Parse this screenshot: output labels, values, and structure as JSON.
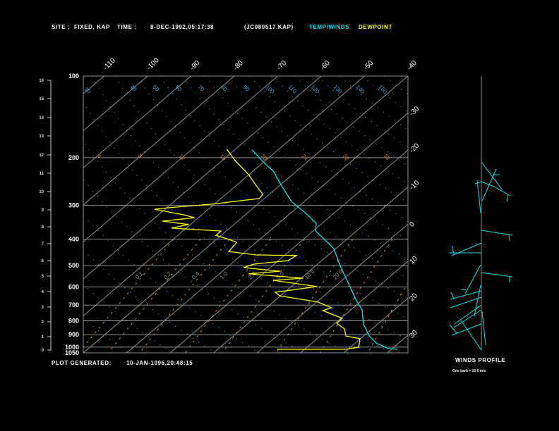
{
  "header": {
    "site_label": "SITE :",
    "site_value": "FIXED, KAP",
    "time_label": "TIME :",
    "time_value": "8-DEC-1992,05:17:38",
    "file": "(JC080517.KAP)",
    "legend_temp": "TEMP/WINDS",
    "legend_dew": "DEWPOINT"
  },
  "footer": {
    "generated_label": "PLOT GENERATED:",
    "generated_value": "10-JAN-1996,20:48:15"
  },
  "winds": {
    "title": "WINDS PROFILE",
    "note": "One barb = 10.0 m/s"
  },
  "colors": {
    "temp": "#00e5ee",
    "dew": "#ffff00",
    "grid": "#909090",
    "adiabat": "#4fa3d9",
    "mixing": "#d9873c"
  },
  "chart_data": {
    "type": "line",
    "title": "Skew-T log-P sounding",
    "pressure_ticks": [
      "100",
      "200",
      "300",
      "400",
      "500",
      "600",
      "700",
      "800",
      "900",
      "1000",
      "1050"
    ],
    "height_ticks_km": [
      "0",
      "1",
      "2",
      "3",
      "4",
      "5",
      "6",
      "7",
      "8",
      "9",
      "10",
      "11",
      "12",
      "13",
      "14",
      "15",
      "16"
    ],
    "isotherm_top_labels": [
      "-110",
      "-100",
      "-90",
      "-80",
      "-70",
      "-60",
      "-50",
      "-40"
    ],
    "isotherm_right_labels": [
      "-30",
      "-20",
      "-10",
      "0",
      "10",
      "20",
      "30"
    ],
    "adiabat_labels": [
      "10",
      "40",
      "50",
      "60",
      "70",
      "80",
      "90",
      "100",
      "110",
      "120",
      "130",
      "140",
      "150"
    ],
    "moist_labels": [
      "4",
      "8",
      "12",
      "16",
      "20",
      "24",
      "28",
      "32"
    ],
    "mixing_labels": [
      "0.1",
      "0.2",
      "0.4",
      "1.0",
      "2.0",
      "5.0",
      "10.0",
      "20.0"
    ],
    "ylim_hpa": [
      1050,
      100
    ],
    "series": [
      {
        "name": "TEMP/WINDS",
        "points": [
          [
            187,
            -56
          ],
          [
            207,
            -50.3
          ],
          [
            224,
            -45.4
          ],
          [
            256,
            -39.1
          ],
          [
            290,
            -33
          ],
          [
            321,
            -26.5
          ],
          [
            349,
            -21.4
          ],
          [
            373,
            -19.4
          ],
          [
            433,
            -10.5
          ],
          [
            509,
            -3.7
          ],
          [
            574,
            1.7
          ],
          [
            674,
            8.8
          ],
          [
            729,
            12.6
          ],
          [
            822,
            16.7
          ],
          [
            910,
            21.3
          ],
          [
            966,
            24.8
          ],
          [
            1013,
            29.1
          ],
          [
            1019,
            31.4
          ]
        ]
      },
      {
        "name": "DEWPOINT",
        "points": [
          [
            186,
            -62
          ],
          [
            205,
            -57
          ],
          [
            231,
            -50.1
          ],
          [
            253,
            -45.5
          ],
          [
            273,
            -41.5
          ],
          [
            283,
            -41.2
          ],
          [
            297,
            -50.6
          ],
          [
            306,
            -59.4
          ],
          [
            310,
            -62.4
          ],
          [
            325,
            -54.2
          ],
          [
            333,
            -50.9
          ],
          [
            343,
            -57.4
          ],
          [
            353,
            -50.4
          ],
          [
            364,
            -53.4
          ],
          [
            371,
            -43.9
          ],
          [
            373,
            -41.2
          ],
          [
            387,
            -41.2
          ],
          [
            401,
            -37
          ],
          [
            411,
            -34.5
          ],
          [
            444,
            -33.9
          ],
          [
            457,
            -26.6
          ],
          [
            459,
            -17.2
          ],
          [
            480,
            -17.8
          ],
          [
            494,
            -24.7
          ],
          [
            509,
            -26.1
          ],
          [
            525,
            -16.7
          ],
          [
            537,
            -23.3
          ],
          [
            557,
            -9.5
          ],
          [
            567,
            -15.9
          ],
          [
            598,
            -4.1
          ],
          [
            628,
            -12.2
          ],
          [
            647,
            -10.1
          ],
          [
            682,
            0.3
          ],
          [
            716,
            5
          ],
          [
            733,
            3.7
          ],
          [
            783,
            10.3
          ],
          [
            817,
            10.4
          ],
          [
            857,
            13.7
          ],
          [
            910,
            15.9
          ],
          [
            931,
            19.9
          ],
          [
            1001,
            21.9
          ],
          [
            1019,
            19.5
          ],
          [
            1019,
            3.7
          ]
        ]
      }
    ]
  }
}
